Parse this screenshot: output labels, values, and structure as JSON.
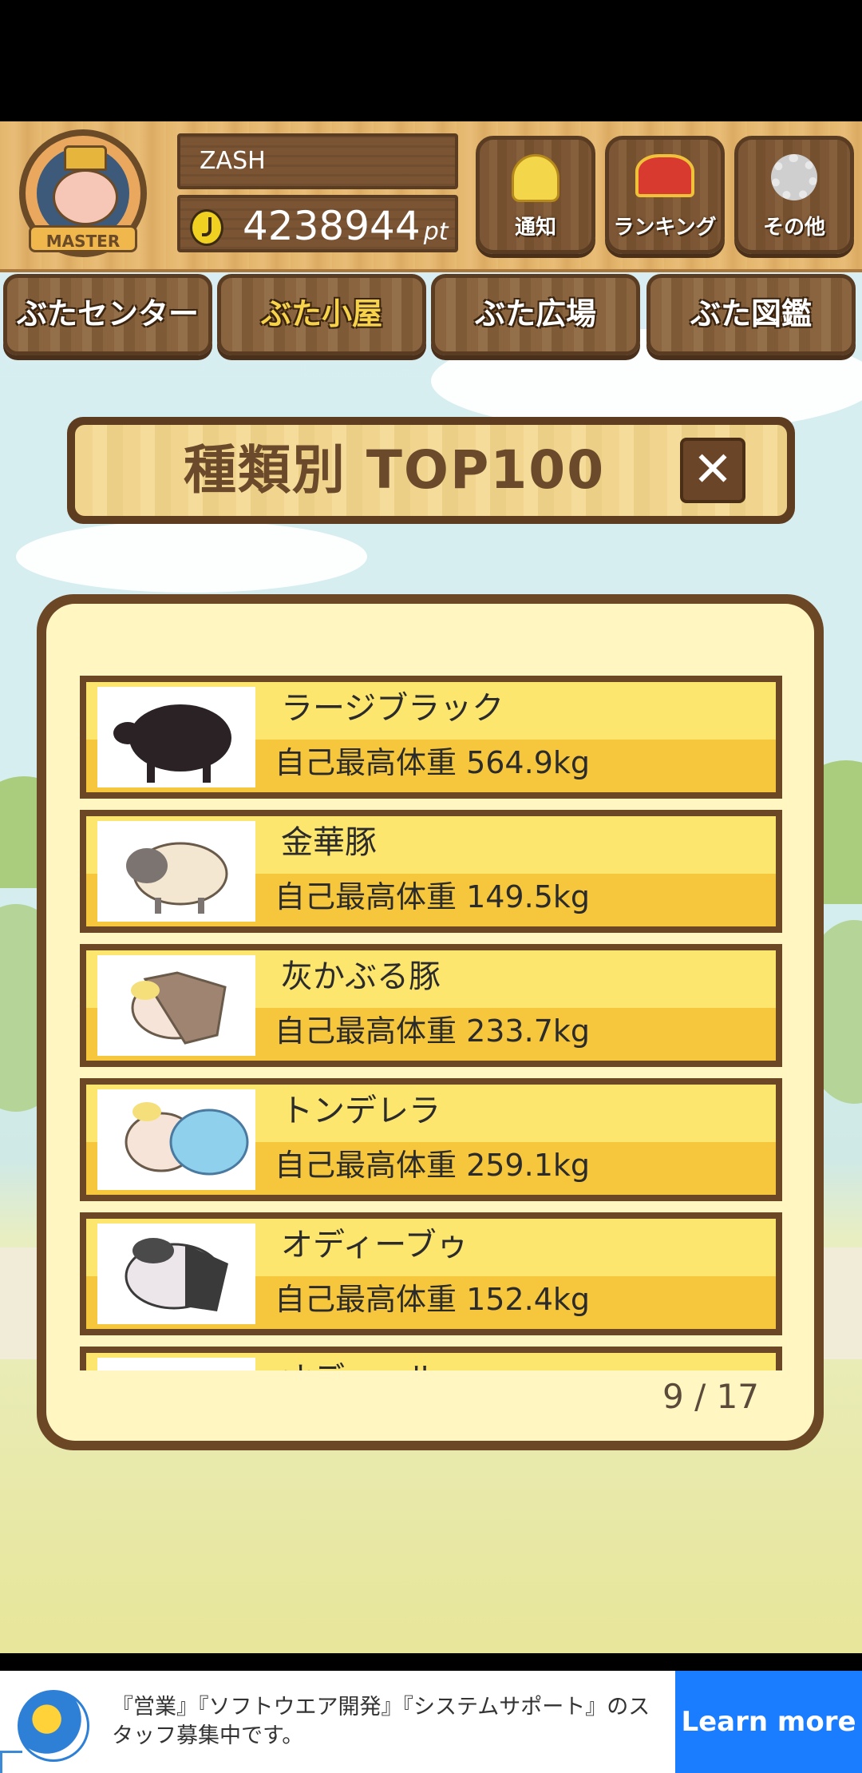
{
  "header": {
    "username": "ZASH",
    "points": "4238944",
    "points_unit": "pt",
    "badge": "MASTER",
    "buttons": [
      {
        "label": "通知",
        "icon": "bell-icon"
      },
      {
        "label": "ランキング",
        "icon": "crown-icon"
      },
      {
        "label": "その他",
        "icon": "gear-icon"
      }
    ]
  },
  "nav": {
    "tabs": [
      {
        "label": "ぶたセンター",
        "active": false
      },
      {
        "label": "ぶた小屋",
        "active": true
      },
      {
        "label": "ぶた広場",
        "active": false
      },
      {
        "label": "ぶた図鑑",
        "active": false
      }
    ]
  },
  "panel": {
    "title": "種類別 TOP100",
    "close_label": "✕",
    "page_indicator": "9 / 17",
    "rows": [
      {
        "name": "ラージブラック",
        "weight": "自己最高体重 564.9kg",
        "pig_color": "#2a2224"
      },
      {
        "name": "金華豚",
        "weight": "自己最高体重 149.5kg",
        "pig_color": "#f3e7d2"
      },
      {
        "name": "灰かぶる豚",
        "weight": "自己最高体重 233.7kg",
        "pig_color": "#f7e4d8"
      },
      {
        "name": "トンデレラ",
        "weight": "自己最高体重 259.1kg",
        "pig_color": "#8fd0ec"
      },
      {
        "name": "オディーブゥ",
        "weight": "自己最高体重 152.4kg",
        "pig_color": "#ece6ea"
      },
      {
        "name": "オディール",
        "weight": "",
        "pig_color": "#3a3a3a"
      }
    ]
  },
  "ad": {
    "text": "『営業』『ソフトウエア開発』『システムサポート』のスタッフ募集中です。",
    "button_label": "Learn more"
  }
}
